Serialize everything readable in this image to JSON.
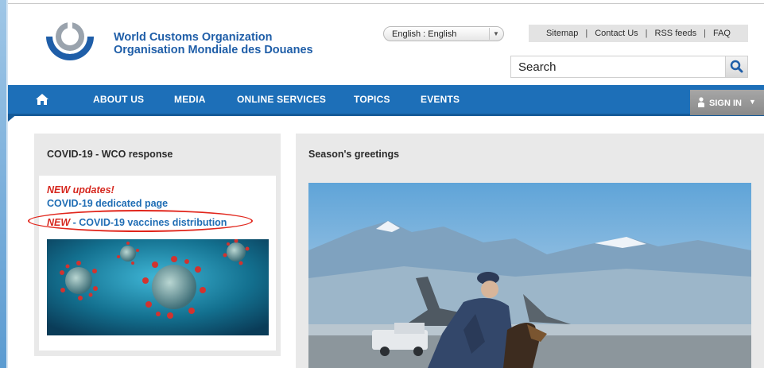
{
  "header": {
    "org_name_en": "World Customs Organization",
    "org_name_fr": "Organisation Mondiale des Douanes",
    "language": "English : English",
    "top_links": [
      "Sitemap",
      "Contact Us",
      "RSS feeds",
      "FAQ"
    ],
    "search_placeholder": "Search"
  },
  "nav": {
    "items": [
      "ABOUT US",
      "MEDIA",
      "ONLINE SERVICES",
      "TOPICS",
      "EVENTS"
    ],
    "sign_in": "SIGN IN"
  },
  "left_panel": {
    "title": "COVID-19 - WCO response",
    "new_updates": "NEW updates!",
    "covid_page_link": "COVID-19 dedicated page",
    "vaccines_new": "NEW",
    "vaccines_link": " - COVID-19 vaccines distribution"
  },
  "right_panel": {
    "title": "Season's greetings"
  },
  "colors": {
    "brand_blue": "#1d6fb8",
    "link_blue": "#1f6db4",
    "alert_red": "#d6281f",
    "panel_gray": "#e9e9e9"
  },
  "icons": [
    "wco-logo",
    "chevron-down-icon",
    "search-icon",
    "home-icon",
    "user-icon",
    "caret-down-icon"
  ]
}
